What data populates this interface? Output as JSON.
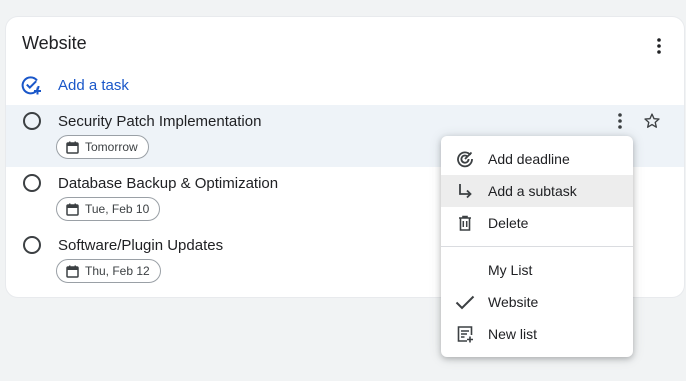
{
  "list": {
    "title": "Website",
    "add_task_label": "Add a task"
  },
  "tasks": [
    {
      "title": "Security Patch Implementation",
      "due": "Tomorrow",
      "starred": false
    },
    {
      "title": "Database Backup & Optimization",
      "due": "Tue, Feb 10"
    },
    {
      "title": "Software/Plugin Updates",
      "due": "Thu, Feb 12"
    }
  ],
  "menu": {
    "actions": [
      {
        "label": "Add deadline",
        "icon": "deadline-icon"
      },
      {
        "label": "Add a subtask",
        "icon": "subtask-arrow-icon"
      },
      {
        "label": "Delete",
        "icon": "trash-icon"
      }
    ],
    "lists": [
      {
        "label": "My List",
        "checked": false
      },
      {
        "label": "Website",
        "checked": true
      },
      {
        "label": "New list",
        "icon": "new-list-icon"
      }
    ]
  },
  "colors": {
    "accent": "#1a57c9",
    "hover_row": "#eef3f8",
    "menu_highlight": "#ededed"
  }
}
